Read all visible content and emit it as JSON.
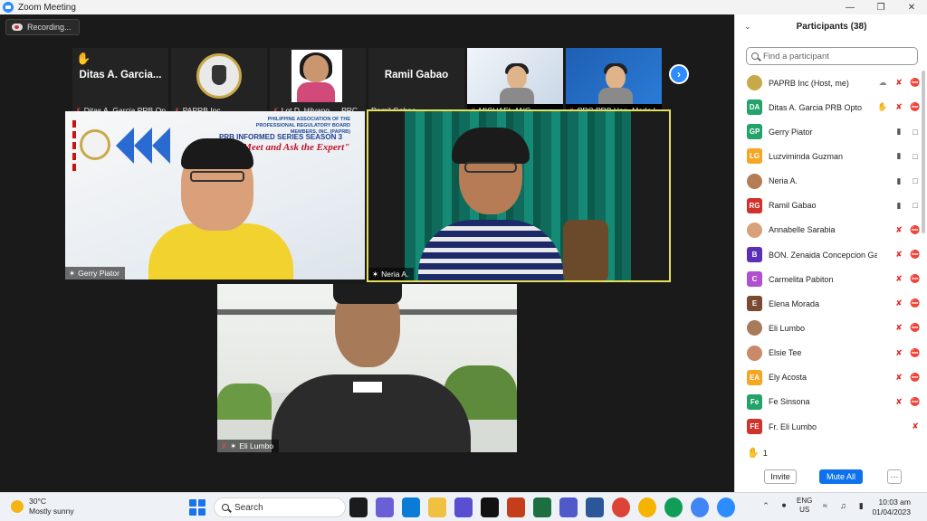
{
  "window": {
    "title": "Zoom Meeting"
  },
  "recording": {
    "label": "Recording..."
  },
  "strip": [
    {
      "bigname": "Ditas A. Garcia...",
      "name": "Ditas A. Garcia PRB Op...",
      "kind": "hand"
    },
    {
      "bigname": "",
      "name": "PAPRB Inc",
      "kind": "logo"
    },
    {
      "bigname": "",
      "name": "Lot D. Hilvano",
      "extra": "PRC",
      "kind": "person"
    },
    {
      "bigname": "Ramil Gabao",
      "name": "Ramil Gabao",
      "kind": "text"
    },
    {
      "bigname": "",
      "name": "MICHAEL ANG",
      "kind": "slide"
    },
    {
      "bigname": "",
      "name": "PRC PRB Hon. Merle L...",
      "kind": "blue"
    }
  ],
  "tiles": {
    "gerry": {
      "name": "Gerry Piator",
      "org": "PHILIPPINE ASSOCIATION OF THE PROFESSIONAL REGULATORY BOARD MEMBERS, INC. (PAPRB)",
      "series": "PRB INFORMED SERIES SEASON 3",
      "tagline": "\"Meet and Ask the Expert\""
    },
    "neria": {
      "name": "Neria A."
    },
    "eli": {
      "name": "Eli Lumbo"
    }
  },
  "panel": {
    "title": "Participants (38)",
    "search_placeholder": "Find a participant",
    "participants": [
      {
        "initials": "",
        "name": "PAPRB Inc (Host, me)",
        "color": "#c8a94a",
        "photo": true,
        "icons": [
          "cloud",
          "mic-off",
          "vid-off"
        ]
      },
      {
        "initials": "DA",
        "name": "Ditas A. Garcia PRB Opto",
        "color": "#23a26a",
        "icons": [
          "hand",
          "mic-off",
          "vid-off"
        ]
      },
      {
        "initials": "GP",
        "name": "Gerry Piator",
        "color": "#23a26a",
        "icons": [
          "mic",
          "vid"
        ]
      },
      {
        "initials": "LG",
        "name": "Luzviminda Guzman",
        "color": "#f5a623",
        "icons": [
          "mic",
          "vid"
        ]
      },
      {
        "initials": "",
        "name": "Neria A.",
        "color": "#b57c55",
        "photo": true,
        "icons": [
          "mic",
          "vid"
        ]
      },
      {
        "initials": "RG",
        "name": "Ramil Gabao",
        "color": "#d0332b",
        "icons": [
          "mic",
          "vid"
        ]
      },
      {
        "initials": "",
        "name": "Annabelle Sarabia",
        "color": "#d7a27a",
        "photo": true,
        "icons": [
          "mic-off",
          "vid-off"
        ]
      },
      {
        "initials": "B",
        "name": "BON. Zenaida Concepcion Gagno",
        "color": "#5b2fb8",
        "icons": [
          "mic-off",
          "vid-off"
        ]
      },
      {
        "initials": "C",
        "name": "Carmelita Pabiton",
        "color": "#b04fd0",
        "icons": [
          "mic-off",
          "vid-off"
        ]
      },
      {
        "initials": "E",
        "name": "Elena Morada",
        "color": "#7a4a33",
        "icons": [
          "mic-off",
          "vid-off"
        ]
      },
      {
        "initials": "",
        "name": "Eli Lumbo",
        "color": "#a77a5a",
        "photo": true,
        "icons": [
          "mic-off",
          "vid-off"
        ]
      },
      {
        "initials": "",
        "name": "Elsie Tee",
        "color": "#c98a6a",
        "photo": true,
        "icons": [
          "mic-off",
          "vid-off"
        ]
      },
      {
        "initials": "EA",
        "name": "Ely Acosta",
        "color": "#f5a623",
        "icons": [
          "mic-off",
          "vid-off"
        ]
      },
      {
        "initials": "Fe",
        "name": "Fe Sinsona",
        "color": "#23a26a",
        "icons": [
          "mic-off",
          "vid-off"
        ]
      },
      {
        "initials": "FE",
        "name": "Fr. Eli Lumbo",
        "color": "#d0332b",
        "icons": [
          "mic-off"
        ]
      }
    ],
    "hand_count": "1",
    "invite_label": "Invite",
    "mute_all_label": "Mute All",
    "more_label": "···"
  },
  "taskbar": {
    "temp": "30°C",
    "weather": "Mostly sunny",
    "search_label": "Search",
    "lang_top": "ENG",
    "lang_bottom": "US",
    "time": "10:03 am",
    "date": "01/04/2023"
  }
}
